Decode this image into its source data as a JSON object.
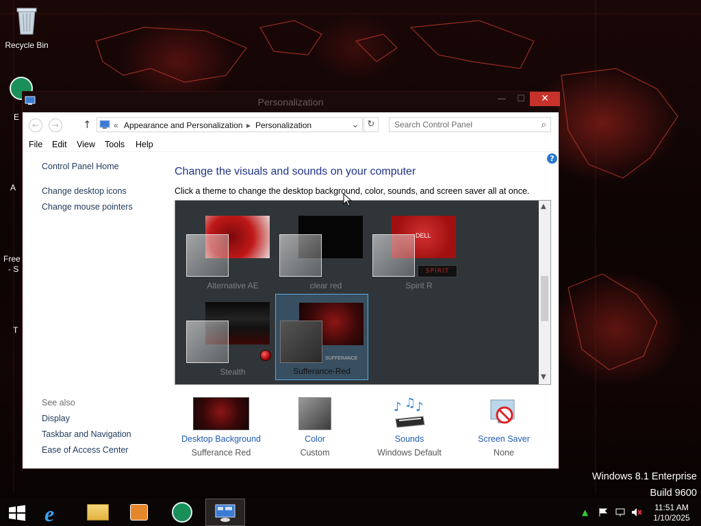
{
  "desktop": {
    "icons": [
      {
        "label": "Recycle Bin",
        "icon": "recycle-bin-icon"
      }
    ],
    "edge_label_1": "E",
    "edge_label_2": "A",
    "edge_label_3": "Free",
    "edge_label_3b": "- S",
    "edge_label_4": "T",
    "edition_line1": "Windows 8.1 Enterprise",
    "edition_line2": "Build 9600"
  },
  "window": {
    "title": "Personalization",
    "close_glyph": "✕",
    "minimize_glyph": "—",
    "maximize_glyph": "☐"
  },
  "address": {
    "chevron": "«",
    "crumbs": [
      "Appearance and Personalization",
      "Personalization"
    ],
    "separator": "▸",
    "dropdown_glyph": "⌄",
    "refresh_glyph": "↻",
    "search_placeholder": "Search Control Panel",
    "back_glyph": "←",
    "forward_glyph": "→",
    "up_glyph": "↑"
  },
  "menu": [
    "File",
    "Edit",
    "View",
    "Tools",
    "Help"
  ],
  "sidebar": {
    "home": "Control Panel Home",
    "links": [
      "Change desktop icons",
      "Change mouse pointers"
    ],
    "see_also_label": "See also",
    "see_also": [
      "Display",
      "Taskbar and Navigation",
      "Ease of Access Center"
    ]
  },
  "main": {
    "heading": "Change the visuals and sounds on your computer",
    "subtext": "Click a theme to change the desktop background, color, sounds, and screen saver all at once.",
    "help_glyph": "?"
  },
  "themes": [
    {
      "name": "Alternative AE",
      "selected": false
    },
    {
      "name": "clear red",
      "selected": false
    },
    {
      "name": "Spirit R",
      "selected": false
    },
    {
      "name": "Stealth",
      "selected": false
    },
    {
      "name": "Sufferance-Red",
      "selected": true
    }
  ],
  "theme_badges": {
    "dell": "DELL",
    "spirit": "SPIRIT",
    "sufferance": "SUFFERANCE"
  },
  "bottom": [
    {
      "link": "Desktop Background",
      "value": "Sufferance Red",
      "icon": "desktop-background-icon"
    },
    {
      "link": "Color",
      "value": "Custom",
      "icon": "color-icon"
    },
    {
      "link": "Sounds",
      "value": "Windows Default",
      "icon": "sounds-icon"
    },
    {
      "link": "Screen Saver",
      "value": "None",
      "icon": "screen-saver-icon"
    }
  ],
  "taskbar": {
    "time": "11:51 AM",
    "date": "1/10/2025",
    "apps": [
      "start-icon",
      "internet-explorer-icon",
      "file-explorer-icon",
      "media-player-icon",
      "green-app-icon",
      "control-panel-icon"
    ]
  }
}
